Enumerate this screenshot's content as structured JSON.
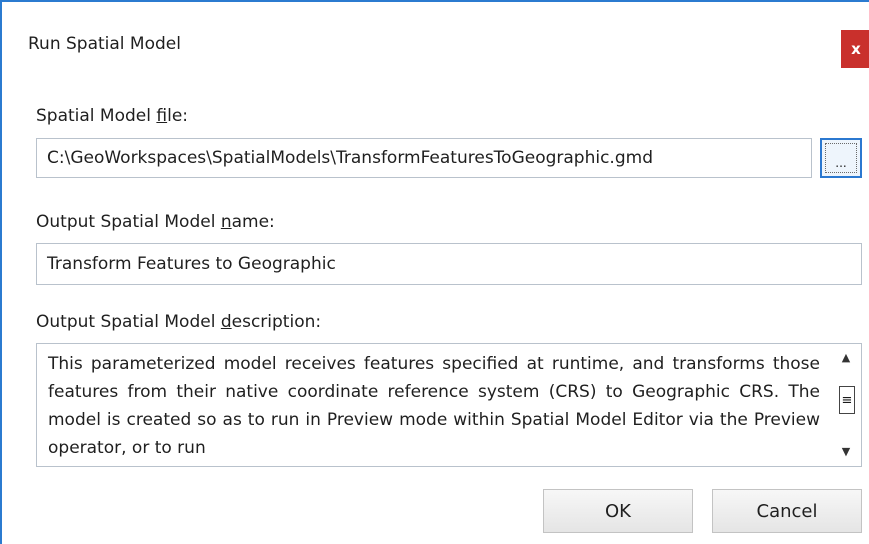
{
  "dialog": {
    "title": "Run Spatial Model",
    "close_label": "x"
  },
  "file_field": {
    "label_before": "Spatial Model ",
    "label_accel": "f",
    "label_after": "ile:",
    "value": "C:\\GeoWorkspaces\\SpatialModels\\TransformFeaturesToGeographic.gmd",
    "browse_label": "..."
  },
  "name_field": {
    "label_before": "Output Spatial Model ",
    "label_accel": "n",
    "label_after": "ame:",
    "value": "Transform Features to Geographic"
  },
  "description_field": {
    "label_before": "Output Spatial Model ",
    "label_accel": "d",
    "label_after": "escription:",
    "value": "This parameterized model receives features specified at runtime, and transforms those features from their native coordinate reference system (CRS) to Geographic CRS.  The model is created so as to run in Preview mode within Spatial Model Editor via the Preview operator, or to run"
  },
  "buttons": {
    "ok": "OK",
    "cancel": "Cancel"
  },
  "icons": {
    "close": "close-icon",
    "scroll_up": "chevron-up-icon",
    "scroll_down": "chevron-down-icon",
    "scroll_thumb": "grip-icon"
  },
  "colors": {
    "window_border": "#2b7bd0",
    "close_button": "#c9302c"
  }
}
